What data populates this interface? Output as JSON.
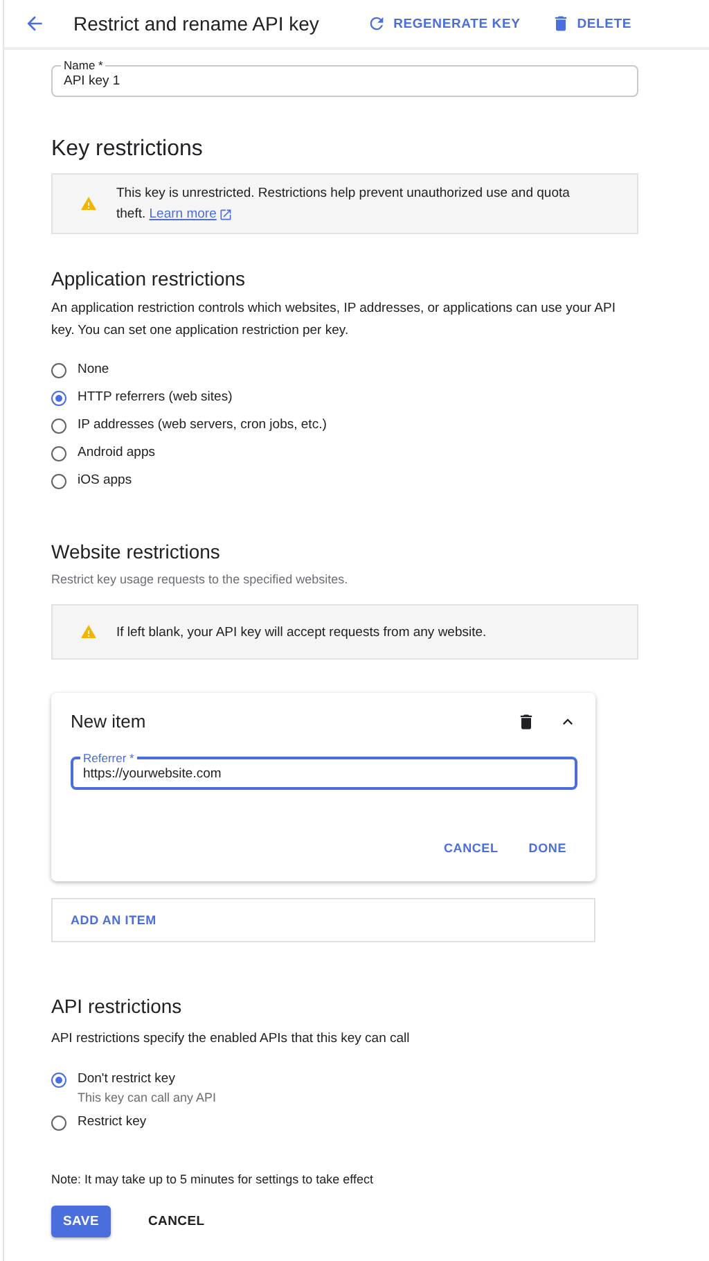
{
  "header": {
    "title": "Restrict and rename API key",
    "actions": [
      {
        "label": "REGENERATE KEY",
        "kind": "regenerate"
      },
      {
        "label": "DELETE",
        "kind": "delete"
      }
    ]
  },
  "name_field": {
    "label": "Name *",
    "value": "API key 1",
    "focused": false
  },
  "key_restrictions": {
    "heading": "Key restrictions",
    "warning": {
      "text": "This key is unrestricted. Restrictions help prevent unauthorized use and quota theft.",
      "link": "Learn more"
    }
  },
  "application_restrictions": {
    "heading": "Application restrictions",
    "description": "An application restriction controls which websites, IP addresses, or applications can use your API key. You can set one application restriction per key.",
    "options": [
      {
        "label": "None",
        "selected": false
      },
      {
        "label": "HTTP referrers (web sites)",
        "selected": true
      },
      {
        "label": "IP addresses (web servers, cron jobs, etc.)",
        "selected": false
      },
      {
        "label": "Android apps",
        "selected": false
      },
      {
        "label": "iOS apps",
        "selected": false
      }
    ]
  },
  "website_restrictions": {
    "heading": "Website restrictions",
    "description": "Restrict key usage requests to the specified websites.",
    "warning": {
      "text": "If left blank, your API key will accept requests from any website."
    },
    "item": {
      "title": "New item",
      "expanded": true,
      "field": {
        "label": "Referrer *",
        "value": "https://yourwebsite.com",
        "focused": true
      },
      "buttons": [
        "CANCEL",
        "DONE"
      ]
    },
    "add_button": "ADD AN ITEM"
  },
  "api_restrictions": {
    "heading": "API restrictions",
    "description": "API restrictions specify the enabled APIs that this key can call",
    "options": [
      {
        "label": "Don't restrict key",
        "hint": "This key can call any API",
        "selected": true
      },
      {
        "label": "Restrict key",
        "selected": false
      }
    ]
  },
  "note": "Note: It may take up to 5 minutes for settings to take effect",
  "buttons": [
    {
      "label": "SAVE",
      "kind": "primary"
    },
    {
      "label": "CANCEL",
      "kind": "text"
    }
  ]
}
